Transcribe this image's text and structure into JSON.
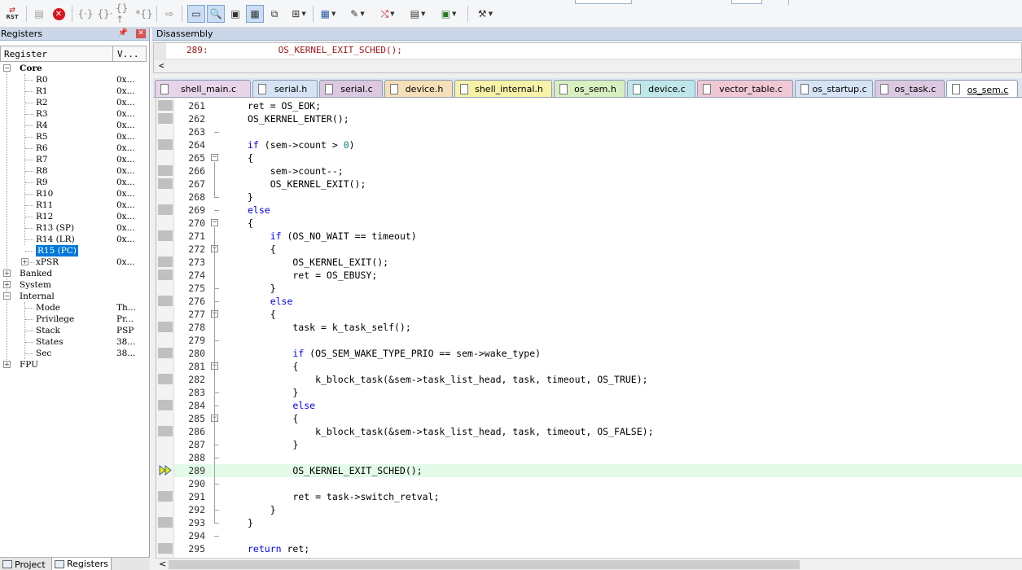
{
  "toolbar": {
    "items": [
      {
        "name": "reset-cpu",
        "label": "RST"
      },
      {
        "name": "run"
      },
      {
        "name": "stop"
      },
      {
        "name": "step-into"
      },
      {
        "name": "step-over"
      },
      {
        "name": "step-out"
      },
      {
        "name": "run-to-cursor"
      },
      {
        "name": "show-next-statement"
      },
      {
        "name": "command-window"
      },
      {
        "name": "disassembly-window"
      },
      {
        "name": "symbols-window"
      },
      {
        "name": "registers-window"
      },
      {
        "name": "call-stack-window"
      },
      {
        "name": "watch-windows"
      },
      {
        "name": "memory-window"
      },
      {
        "name": "serial-window"
      },
      {
        "name": "analysis-windows"
      },
      {
        "name": "trace-windows"
      },
      {
        "name": "system-viewer"
      },
      {
        "name": "toolbox"
      }
    ]
  },
  "registers_panel": {
    "title": "Registers",
    "columns": [
      "Register",
      "V..."
    ],
    "groups": {
      "core": "Core",
      "banked": "Banked",
      "system": "System",
      "internal": "Internal",
      "fpu": "FPU"
    },
    "core": [
      {
        "name": "R0",
        "value": "0x..."
      },
      {
        "name": "R1",
        "value": "0x..."
      },
      {
        "name": "R2",
        "value": "0x..."
      },
      {
        "name": "R3",
        "value": "0x..."
      },
      {
        "name": "R4",
        "value": "0x..."
      },
      {
        "name": "R5",
        "value": "0x..."
      },
      {
        "name": "R6",
        "value": "0x..."
      },
      {
        "name": "R7",
        "value": "0x..."
      },
      {
        "name": "R8",
        "value": "0x..."
      },
      {
        "name": "R9",
        "value": "0x..."
      },
      {
        "name": "R10",
        "value": "0x..."
      },
      {
        "name": "R11",
        "value": "0x..."
      },
      {
        "name": "R12",
        "value": "0x..."
      },
      {
        "name": "R13 (SP)",
        "value": "0x..."
      },
      {
        "name": "R14 (LR)",
        "value": "0x..."
      },
      {
        "name": "R15 (PC)",
        "value": "0x..."
      },
      {
        "name": "xPSR",
        "value": "0x..."
      }
    ],
    "internal": [
      {
        "name": "Mode",
        "value": "Th..."
      },
      {
        "name": "Privilege",
        "value": "Pr..."
      },
      {
        "name": "Stack",
        "value": "PSP"
      },
      {
        "name": "States",
        "value": "38..."
      },
      {
        "name": "Sec",
        "value": "38..."
      }
    ],
    "bottom_tabs": [
      "Project",
      "Registers"
    ]
  },
  "disassembly": {
    "title": "Disassembly",
    "line": "289:             OS_KERNEL_EXIT_SCHED();"
  },
  "editor": {
    "tabs": [
      {
        "label": "shell_main.c",
        "color": "#e8d4e8"
      },
      {
        "label": "serial.h",
        "color": "#d5e3f5"
      },
      {
        "label": "serial.c",
        "color": "#dcc8e0"
      },
      {
        "label": "device.h",
        "color": "#f5dfb8"
      },
      {
        "label": "shell_internal.h",
        "color": "#f7f2a8"
      },
      {
        "label": "os_sem.h",
        "color": "#d8f0c0"
      },
      {
        "label": "device.c",
        "color": "#bfe6e8"
      },
      {
        "label": "vector_table.c",
        "color": "#f0c8d4"
      },
      {
        "label": "os_startup.c",
        "color": "#d5e3f5"
      },
      {
        "label": "os_task.c",
        "color": "#dcc8e0"
      },
      {
        "label": "os_sem.c",
        "color": "#f5dfb8"
      }
    ],
    "active_tab": "os_sem.c",
    "current_line": "289",
    "lines": [
      {
        "no": "261",
        "code": "ret = OS_EOK;"
      },
      {
        "no": "262",
        "code": "OS_KERNEL_ENTER();"
      },
      {
        "no": "263",
        "code": ""
      },
      {
        "no": "264",
        "code": "if (sem->count > 0)"
      },
      {
        "no": "265",
        "code": "{"
      },
      {
        "no": "266",
        "code": "    sem->count--;"
      },
      {
        "no": "267",
        "code": "    OS_KERNEL_EXIT();"
      },
      {
        "no": "268",
        "code": "}"
      },
      {
        "no": "269",
        "code": "else"
      },
      {
        "no": "270",
        "code": "{"
      },
      {
        "no": "271",
        "code": "    if (OS_NO_WAIT == timeout)"
      },
      {
        "no": "272",
        "code": "    {"
      },
      {
        "no": "273",
        "code": "        OS_KERNEL_EXIT();"
      },
      {
        "no": "274",
        "code": "        ret = OS_EBUSY;"
      },
      {
        "no": "275",
        "code": "    }"
      },
      {
        "no": "276",
        "code": "    else"
      },
      {
        "no": "277",
        "code": "    {"
      },
      {
        "no": "278",
        "code": "        task = k_task_self();"
      },
      {
        "no": "279",
        "code": ""
      },
      {
        "no": "280",
        "code": "        if (OS_SEM_WAKE_TYPE_PRIO == sem->wake_type)"
      },
      {
        "no": "281",
        "code": "        {"
      },
      {
        "no": "282",
        "code": "            k_block_task(&sem->task_list_head, task, timeout, OS_TRUE);"
      },
      {
        "no": "283",
        "code": "        }"
      },
      {
        "no": "284",
        "code": "        else"
      },
      {
        "no": "285",
        "code": "        {"
      },
      {
        "no": "286",
        "code": "            k_block_task(&sem->task_list_head, task, timeout, OS_FALSE);"
      },
      {
        "no": "287",
        "code": "        }"
      },
      {
        "no": "288",
        "code": ""
      },
      {
        "no": "289",
        "code": "        OS_KERNEL_EXIT_SCHED();"
      },
      {
        "no": "290",
        "code": ""
      },
      {
        "no": "291",
        "code": "        ret = task->switch_retval;"
      },
      {
        "no": "292",
        "code": "    }"
      },
      {
        "no": "293",
        "code": "}"
      },
      {
        "no": "294",
        "code": ""
      },
      {
        "no": "295",
        "code": "return ret;"
      }
    ]
  }
}
